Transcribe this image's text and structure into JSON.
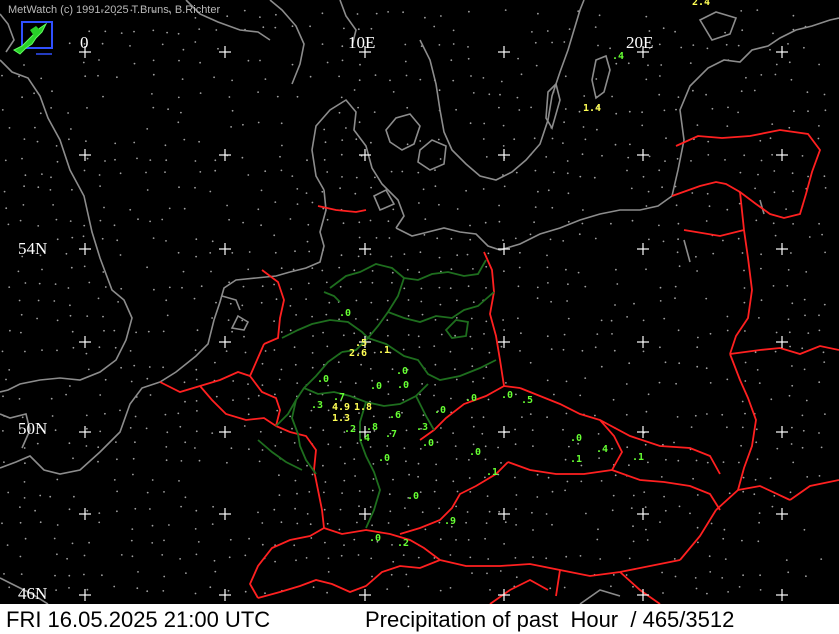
{
  "credit": "MetWatch  (c) 1991-2025 T.Bruns, B.Richter",
  "logo_icon": "metwatch-logo-icon",
  "grid_labels": {
    "lon_0": "0",
    "lon_10e": "10E",
    "lon_20e": "20E",
    "lat_54n": "54N",
    "lat_50n": "50N",
    "lat_46n": "46N"
  },
  "status_bar": {
    "datetime": "FRI 16.05.2025 21:00 UTC",
    "title": "Precipitation of past  Hour  / 465/3512"
  },
  "colors": {
    "background": "#000000",
    "coast": "#8c8c8c",
    "national_border": "#ff2020",
    "german_states": "#1e6e1e",
    "value_small": "#66ff33",
    "value_large": "#ffff55"
  },
  "observations": [
    {
      "id": "o1",
      "text": "2.4",
      "color": "yellow"
    },
    {
      "id": "o2",
      "text": ".4",
      "color": "green"
    },
    {
      "id": "o3",
      "text": "1.4",
      "color": "yellow"
    },
    {
      "id": "o4",
      "text": ".0",
      "color": "green"
    },
    {
      "id": "o5",
      "text": ".5",
      "color": "yellow"
    },
    {
      "id": "o6",
      "text": "2.6",
      "color": "yellow"
    },
    {
      "id": "o7",
      "text": ".1",
      "color": "yellow"
    },
    {
      "id": "o8",
      "text": ".0",
      "color": "green"
    },
    {
      "id": "o9",
      "text": ".0",
      "color": "green"
    },
    {
      "id": "o10",
      "text": ".0",
      "color": "green"
    },
    {
      "id": "o11",
      "text": ".0",
      "color": "green"
    },
    {
      "id": "o12",
      "text": ".7",
      "color": "green"
    },
    {
      "id": "o13",
      "text": ".3",
      "color": "green"
    },
    {
      "id": "o14",
      "text": "4.9",
      "color": "yellow"
    },
    {
      "id": "o15",
      "text": "1.8",
      "color": "yellow"
    },
    {
      "id": "o16",
      "text": "1.3",
      "color": "yellow"
    },
    {
      "id": "o17",
      "text": ".2",
      "color": "green"
    },
    {
      "id": "o18",
      "text": ".8",
      "color": "green"
    },
    {
      "id": "o19",
      "text": ".4",
      "color": "green"
    },
    {
      "id": "o20",
      "text": ".6",
      "color": "green"
    },
    {
      "id": "o21",
      "text": ".7",
      "color": "green"
    },
    {
      "id": "o22",
      "text": ".0",
      "color": "green"
    },
    {
      "id": "o23",
      "text": ".0",
      "color": "green"
    },
    {
      "id": "o24",
      "text": ".0",
      "color": "green"
    },
    {
      "id": "o25",
      "text": ".5",
      "color": "green"
    },
    {
      "id": "o26",
      "text": ".3",
      "color": "green"
    },
    {
      "id": "o27",
      "text": ".0",
      "color": "green"
    },
    {
      "id": "o28",
      "text": ".0",
      "color": "green"
    },
    {
      "id": "o29",
      "text": ".0",
      "color": "green"
    },
    {
      "id": "o30",
      "text": ".0",
      "color": "green"
    },
    {
      "id": "o31",
      "text": ".1",
      "color": "green"
    },
    {
      "id": "o32",
      "text": ".4",
      "color": "green"
    },
    {
      "id": "o33",
      "text": ".1",
      "color": "green"
    },
    {
      "id": "o34",
      "text": ".1",
      "color": "green"
    },
    {
      "id": "o35",
      "text": ".0",
      "color": "green"
    },
    {
      "id": "o36",
      "text": ".9",
      "color": "green"
    },
    {
      "id": "o37",
      "text": ".0",
      "color": "green"
    },
    {
      "id": "o38",
      "text": ".2",
      "color": "green"
    }
  ]
}
